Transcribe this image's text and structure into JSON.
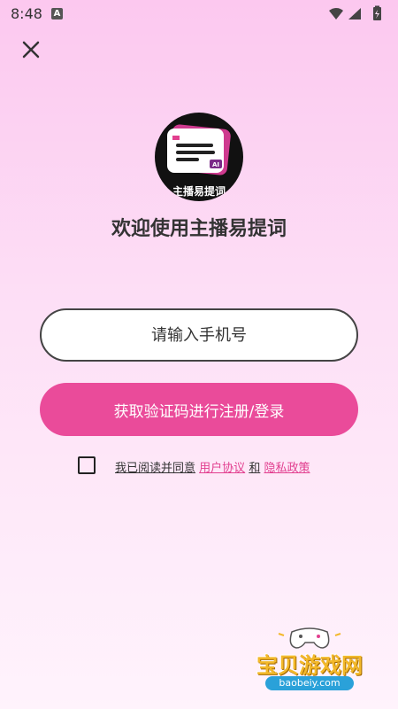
{
  "status_bar": {
    "time": "8:48",
    "notification_letter": "A"
  },
  "header": {
    "close_icon": "close-icon"
  },
  "logo": {
    "text": "主播易提词",
    "badge": "AI"
  },
  "welcome": {
    "title": "欢迎使用主播易提词"
  },
  "form": {
    "phone_placeholder": "请输入手机号",
    "phone_value": "",
    "submit_label": "获取验证码进行注册/登录"
  },
  "agreement": {
    "checked": false,
    "prefix": "我已阅读并同意",
    "user_agreement": "用户协议",
    "and": "和",
    "privacy_policy": "隐私政策"
  },
  "watermark": {
    "title": "宝贝游戏网",
    "url": "baobeiy.com"
  },
  "colors": {
    "accent": "#ea4b9a",
    "link": "#e23f8f",
    "text": "#333333"
  }
}
